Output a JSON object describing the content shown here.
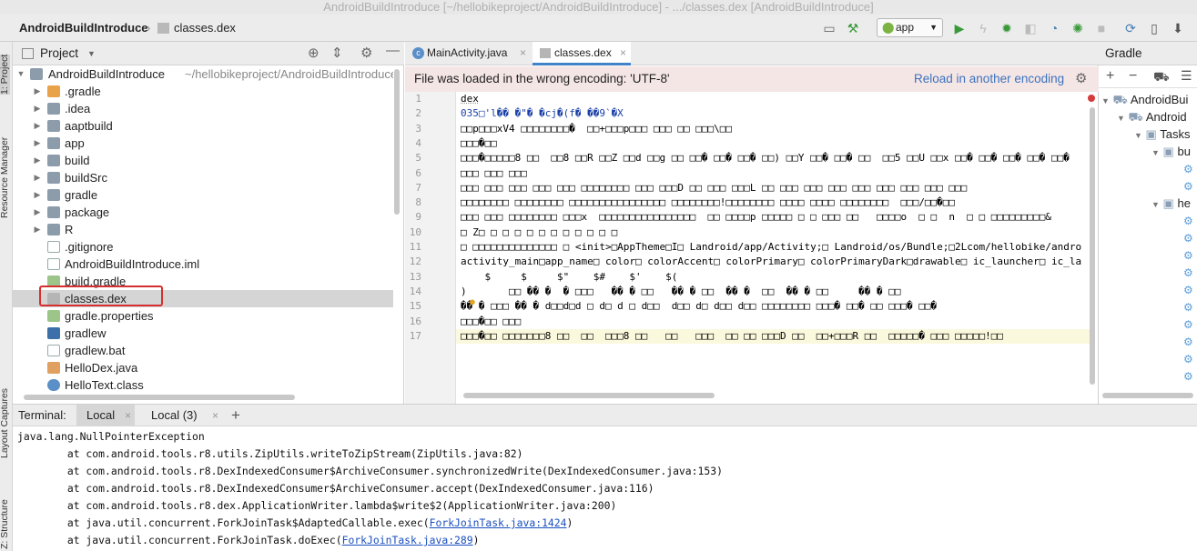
{
  "window": {
    "title": "AndroidBuildIntroduce [~/hellobikeproject/AndroidBuildIntroduce] - .../classes.dex [AndroidBuildIntroduce]"
  },
  "breadcrumb": {
    "project": "AndroidBuildIntroduce",
    "file": "classes.dex"
  },
  "toolbar": {
    "run_config": "app"
  },
  "left_strip": {
    "project_tab": "1: Project",
    "resource_tab": "Resource Manager",
    "layout_tab": "Layout Captures",
    "structure_tab": "Z: Structure"
  },
  "project_panel": {
    "title": "Project",
    "root": {
      "label": "AndroidBuildIntroduce",
      "path": "~/hellobikeproject/AndroidBuildIntroduce"
    },
    "items": [
      {
        "label": ".gradle"
      },
      {
        "label": ".idea"
      },
      {
        "label": "aaptbuild"
      },
      {
        "label": "app"
      },
      {
        "label": "build"
      },
      {
        "label": "buildSrc"
      },
      {
        "label": "gradle"
      },
      {
        "label": "package"
      },
      {
        "label": "R"
      },
      {
        "label": ".gitignore"
      },
      {
        "label": "AndroidBuildIntroduce.iml"
      },
      {
        "label": "build.gradle"
      },
      {
        "label": "classes.dex"
      },
      {
        "label": "gradle.properties"
      },
      {
        "label": "gradlew"
      },
      {
        "label": "gradlew.bat"
      },
      {
        "label": "HelloDex.java"
      },
      {
        "label": "HelloText.class"
      }
    ]
  },
  "editor": {
    "tabs": [
      {
        "label": "MainActivity.java"
      },
      {
        "label": "classes.dex"
      }
    ],
    "banner": {
      "message": "File was loaded in the wrong encoding: 'UTF-8'",
      "action": "Reload in another encoding"
    },
    "line_numbers": [
      "1",
      "2",
      "3",
      "4",
      "5",
      "6",
      "7",
      "8",
      "9",
      "10",
      "11",
      "12",
      "13",
      "14",
      "15",
      "16",
      "17"
    ],
    "lines": [
      "dex",
      "035□'l�� �\"� �cj�(f� ��9`�X",
      "□□p□□□xV4 □□□□□□□□�  □□+□□□p□□□ □□□ □□ □□□\\□□",
      "□□□�□□",
      "□□□�□□□□□8 □□  □□8 □□R □□Z □□d □□g □□ □□� □□� □□� □□) □□Y □□� □□� □□  □□5 □□U □□x □□� □□� □□� □□� □□�",
      "□□□ □□□ □□□",
      "□□□ □□□ □□□ □□□ □□□ □□□□□□□□ □□□ □□□D □□ □□□ □□□L □□ □□□ □□□ □□□ □□□ □□□ □□□ □□□ □□□",
      "□□□□□□□□ □□□□□□□□ □□□□□□□□□□□□□□□□ □□□□□□□□!□□□□□□□□ □□□□ □□□□ □□□□□□□□  □□□/□□�□□",
      "□□□ □□□ □□□□□□□□ □□□x  □□□□□□□□□□□□□□□□  □□ □□□□p □□□□□ □ □ □□□ □□   □□□□o  □ □  n  □ □ □□□□□□□□□&",
      "□ Z□ □ □ □ □ □ □ □ □ □ □ □",
      "□ □□□□□□□□□□□□□□ □ <init>□AppTheme□I□ Landroid/app/Activity;□ Landroid/os/Bundle;□2Lcom/hellobike/andro",
      "activity_main□app_name□ color□ colorAccent□ colorPrimary□ colorPrimaryDark□drawable□ ic_launcher□ ic_la",
      "    $     $     $\"    $#    $'    $(",
      ")       □□ �� �  � □□□   �� � □□   �� � □□  �� �  □□  �� � □□     �� � □□",
      "�� � □□□ �� � d□□d□d □ d□ d □ d□□  d□□ d□ d□□ d□□ □□□□□□□□ □□□� □□� □□ □□□� □□�",
      "□□□�□□ □□□",
      "□□□�□□ □□□□□□□8 □□  □□  □□□8 □□   □□   □□□  □□ □□ □□□D □□  □□+□□□R □□  □□□□□� □□□ □□□□□!□□"
    ]
  },
  "gradle_panel": {
    "title": "Gradle",
    "items": [
      {
        "label": "AndroidBui"
      },
      {
        "label": "Android"
      },
      {
        "label": "Tasks"
      },
      {
        "label": "bu"
      },
      {
        "label": "he"
      }
    ]
  },
  "terminal": {
    "label": "Terminal:",
    "tabs": [
      {
        "label": "Local"
      },
      {
        "label": "Local (3)"
      }
    ],
    "lines": [
      {
        "text": "java.lang.NullPointerException",
        "link": ""
      },
      {
        "text": "        at com.android.tools.r8.utils.ZipUtils.writeToZipStream(ZipUtils.java:82)",
        "link": ""
      },
      {
        "text": "        at com.android.tools.r8.DexIndexedConsumer$ArchiveConsumer.synchronizedWrite(DexIndexedConsumer.java:153)",
        "link": ""
      },
      {
        "text": "        at com.android.tools.r8.DexIndexedConsumer$ArchiveConsumer.accept(DexIndexedConsumer.java:116)",
        "link": ""
      },
      {
        "text": "        at com.android.tools.r8.dex.ApplicationWriter.lambda$write$2(ApplicationWriter.java:200)",
        "link": ""
      },
      {
        "text": "        at java.util.concurrent.ForkJoinTask$AdaptedCallable.exec(",
        "link": "ForkJoinTask.java:1424",
        "suffix": ")"
      },
      {
        "text": "        at java.util.concurrent.ForkJoinTask.doExec(",
        "link": "ForkJoinTask.java:289",
        "suffix": ")"
      }
    ]
  }
}
